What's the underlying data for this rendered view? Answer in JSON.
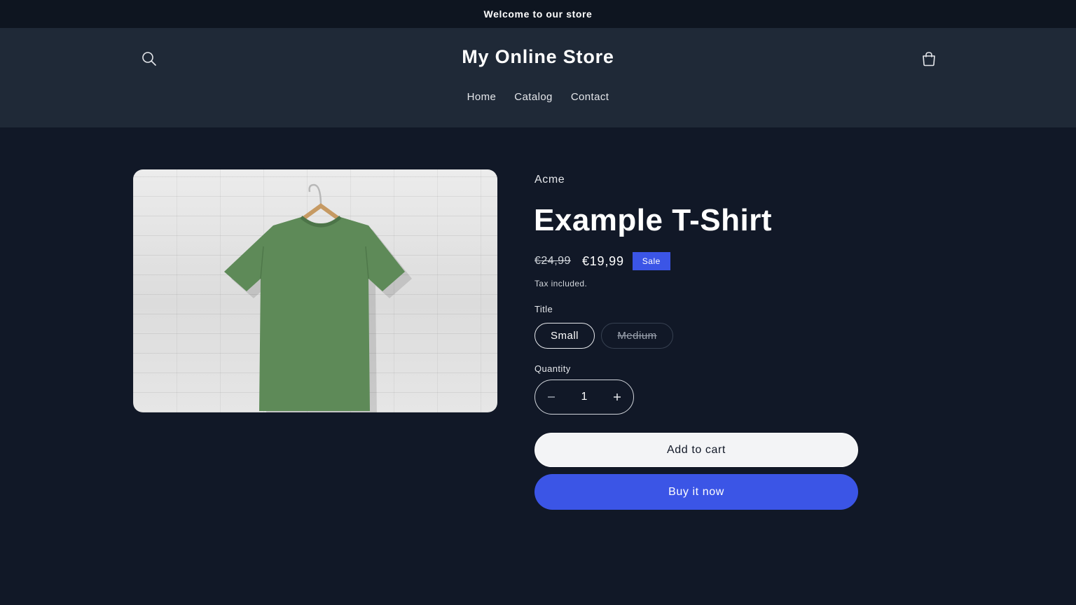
{
  "announcement": {
    "text": "Welcome to our store"
  },
  "header": {
    "store_name": "My Online Store",
    "search_icon": "search-icon",
    "cart_icon": "cart-icon",
    "nav": [
      {
        "label": "Home"
      },
      {
        "label": "Catalog"
      },
      {
        "label": "Contact"
      }
    ]
  },
  "product": {
    "image_icon": "t-shirt-on-hanger",
    "vendor": "Acme",
    "title": "Example T-Shirt",
    "price_original": "€24,99",
    "price_sale": "€19,99",
    "sale_badge": "Sale",
    "tax_note": "Tax included.",
    "option_label": "Title",
    "options": [
      {
        "label": "Small",
        "selected": true,
        "available": true
      },
      {
        "label": "Medium",
        "selected": false,
        "available": false
      }
    ],
    "quantity_label": "Quantity",
    "quantity": "1",
    "add_to_cart_label": "Add to cart",
    "buy_now_label": "Buy it now"
  },
  "colors": {
    "background": "#111827",
    "header": "#1f2937",
    "announcement": "#0e1520",
    "accent": "#3b55e6",
    "shirt": "#5e8a58"
  }
}
